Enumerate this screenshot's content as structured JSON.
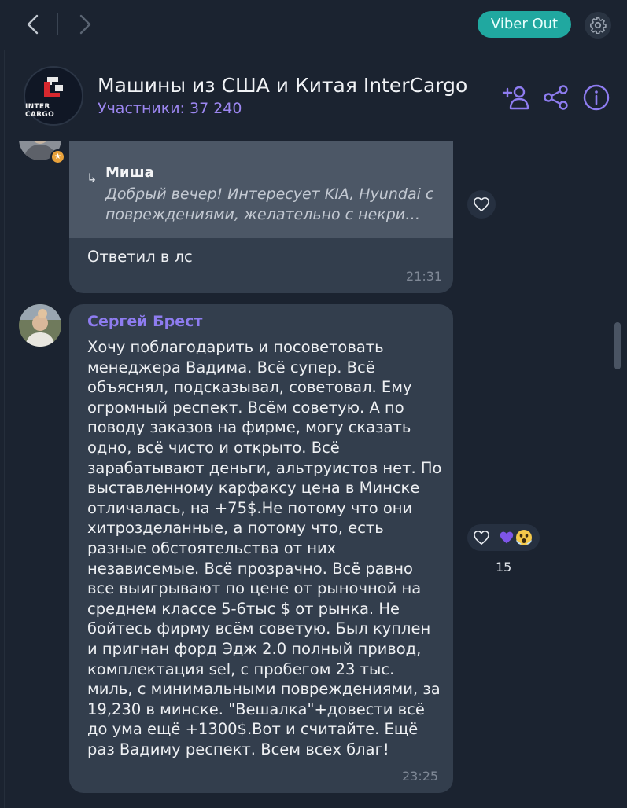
{
  "topbar": {
    "viber_out_label": "Viber Out"
  },
  "chat": {
    "title": "Машины из США и Китая InterCargo",
    "subtitle": "Участники: 37 240",
    "logo_text": "INTER CARGO"
  },
  "messages": [
    {
      "quote": {
        "name": "Миша",
        "text": "Добрый вечер! Интересует   KIA, Hyundai с повреждениями, желательно с некри…"
      },
      "text": "Ответил в лс",
      "time": "21:31",
      "admin_badge": "★"
    },
    {
      "sender": "Сергей Брест",
      "lines": [
        "Хочу поблагодарить и посоветовать",
        "менеджера Вадима. Всё супер. Всё",
        "объяснял, подсказывал, советовал. Ему",
        "огромный респект. Всём советую. А по",
        "поводу заказов на фирме, могу сказать",
        "одно, всё чисто и открыто. Всё",
        "зарабатывают деньги, альтруистов нет. По",
        "выставленному карфаксу цена в Минске",
        "отличалась, на +75$.Не потому что они",
        "хитрозделанные, а потому что, есть",
        "разные обстоятельства от них",
        "независемые. Всё прозрачно. Всё равно",
        "все выигрывают по цене от рыночной на",
        "среднем классе 5-6тыс $ от рынка. Не",
        "бойтесь фирму всём советую. Был куплен",
        "и пригнан форд Эдж 2.0 полный привод,",
        "комплектация sel, с пробегом 23 тыс.",
        "миль, с минимальными повреждениями, за",
        "19,230 в минске. \"Вешалка\"+довести всё",
        "до ума ещё +1300$.Вот и считайте. Ещё",
        "раз Вадиму респект. Всем всех благ!"
      ],
      "time": "23:25",
      "reactions": {
        "emojis": [
          "💜",
          "😱"
        ],
        "count": "15"
      }
    }
  ],
  "colors": {
    "background": "#1b2330",
    "bubble": "#333e4d",
    "accent_purple": "#8e7cf0",
    "viber_out": "#20a8a0"
  }
}
